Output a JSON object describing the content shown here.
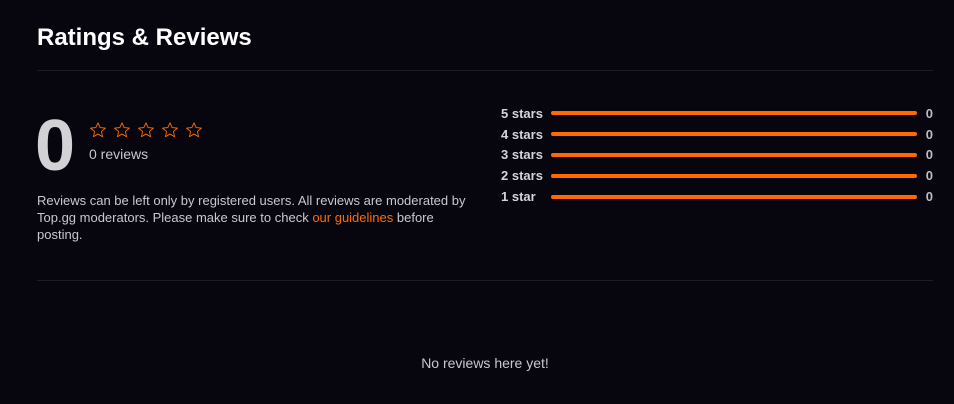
{
  "header": {
    "title": "Ratings & Reviews"
  },
  "summary": {
    "average": "0",
    "stars_filled": 0,
    "stars_total": 5,
    "review_count_label": "0 reviews",
    "star_color": "#ff6a00"
  },
  "notice": {
    "text_before": "Reviews can be left only by registered users. All reviews are moderated by Top.gg moderators. Please make sure to check ",
    "link": "our guidelines",
    "text_after": " before posting."
  },
  "breakdown": [
    {
      "label": "5 stars",
      "count": "0"
    },
    {
      "label": "4 stars",
      "count": "0"
    },
    {
      "label": "3 stars",
      "count": "0"
    },
    {
      "label": "2 stars",
      "count": "0"
    },
    {
      "label": "1 star",
      "count": "0"
    }
  ],
  "empty_state": "No reviews here yet!"
}
